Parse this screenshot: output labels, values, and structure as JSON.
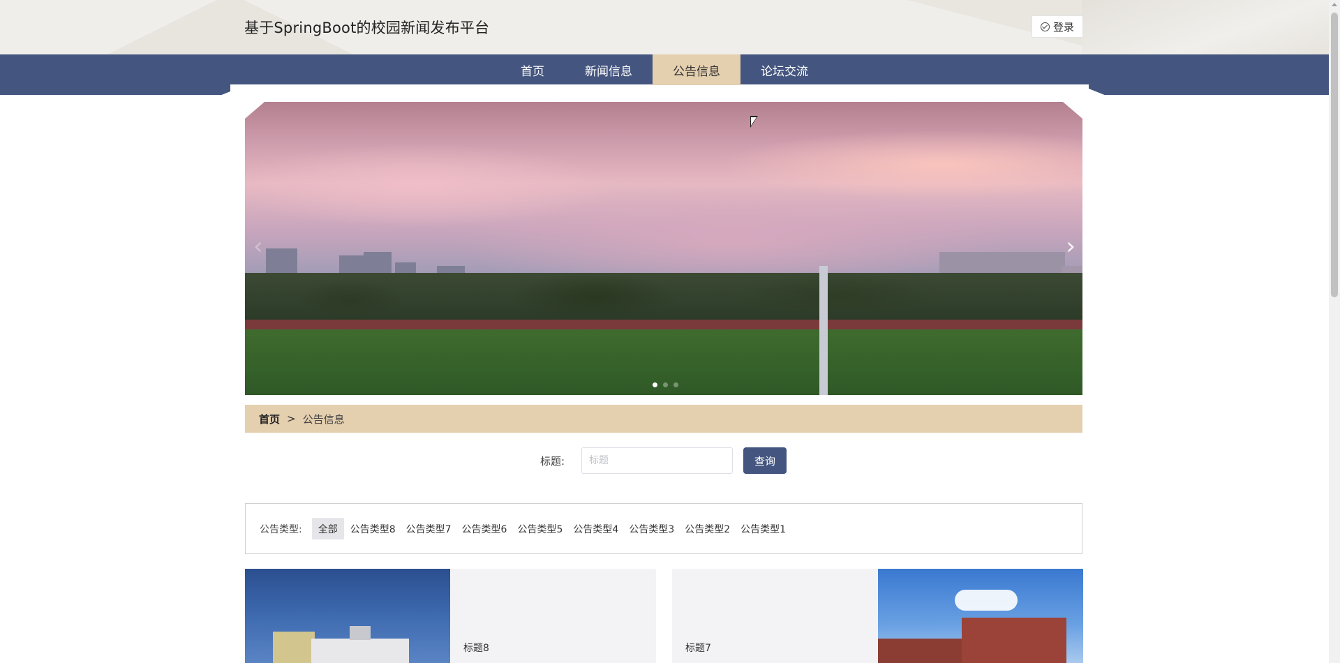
{
  "header": {
    "site_title": "基于SpringBoot的校园新闻发布平台",
    "login_label": "登录"
  },
  "nav": {
    "items": [
      {
        "label": "首页"
      },
      {
        "label": "新闻信息"
      },
      {
        "label": "公告信息"
      },
      {
        "label": "论坛交流"
      }
    ],
    "active_index": 2
  },
  "carousel": {
    "prev_icon": "‹",
    "next_icon": "›",
    "slide_count": 3,
    "active_slide": 0
  },
  "breadcrumb": {
    "home": "首页",
    "separator": ">",
    "current": "公告信息"
  },
  "search": {
    "label": "标题:",
    "placeholder": "标题",
    "value": "",
    "button_label": "查询"
  },
  "filter": {
    "label": "公告类型:",
    "items": [
      "全部",
      "公告类型8",
      "公告类型7",
      "公告类型6",
      "公告类型5",
      "公告类型4",
      "公告类型3",
      "公告类型2",
      "公告类型1"
    ],
    "active_index": 0
  },
  "cards": [
    {
      "title": "标题8"
    },
    {
      "title": "标题7"
    }
  ],
  "colors": {
    "nav_bg": "#44557f",
    "accent_beige": "#e4cfaf",
    "button_bg": "#44557f"
  }
}
